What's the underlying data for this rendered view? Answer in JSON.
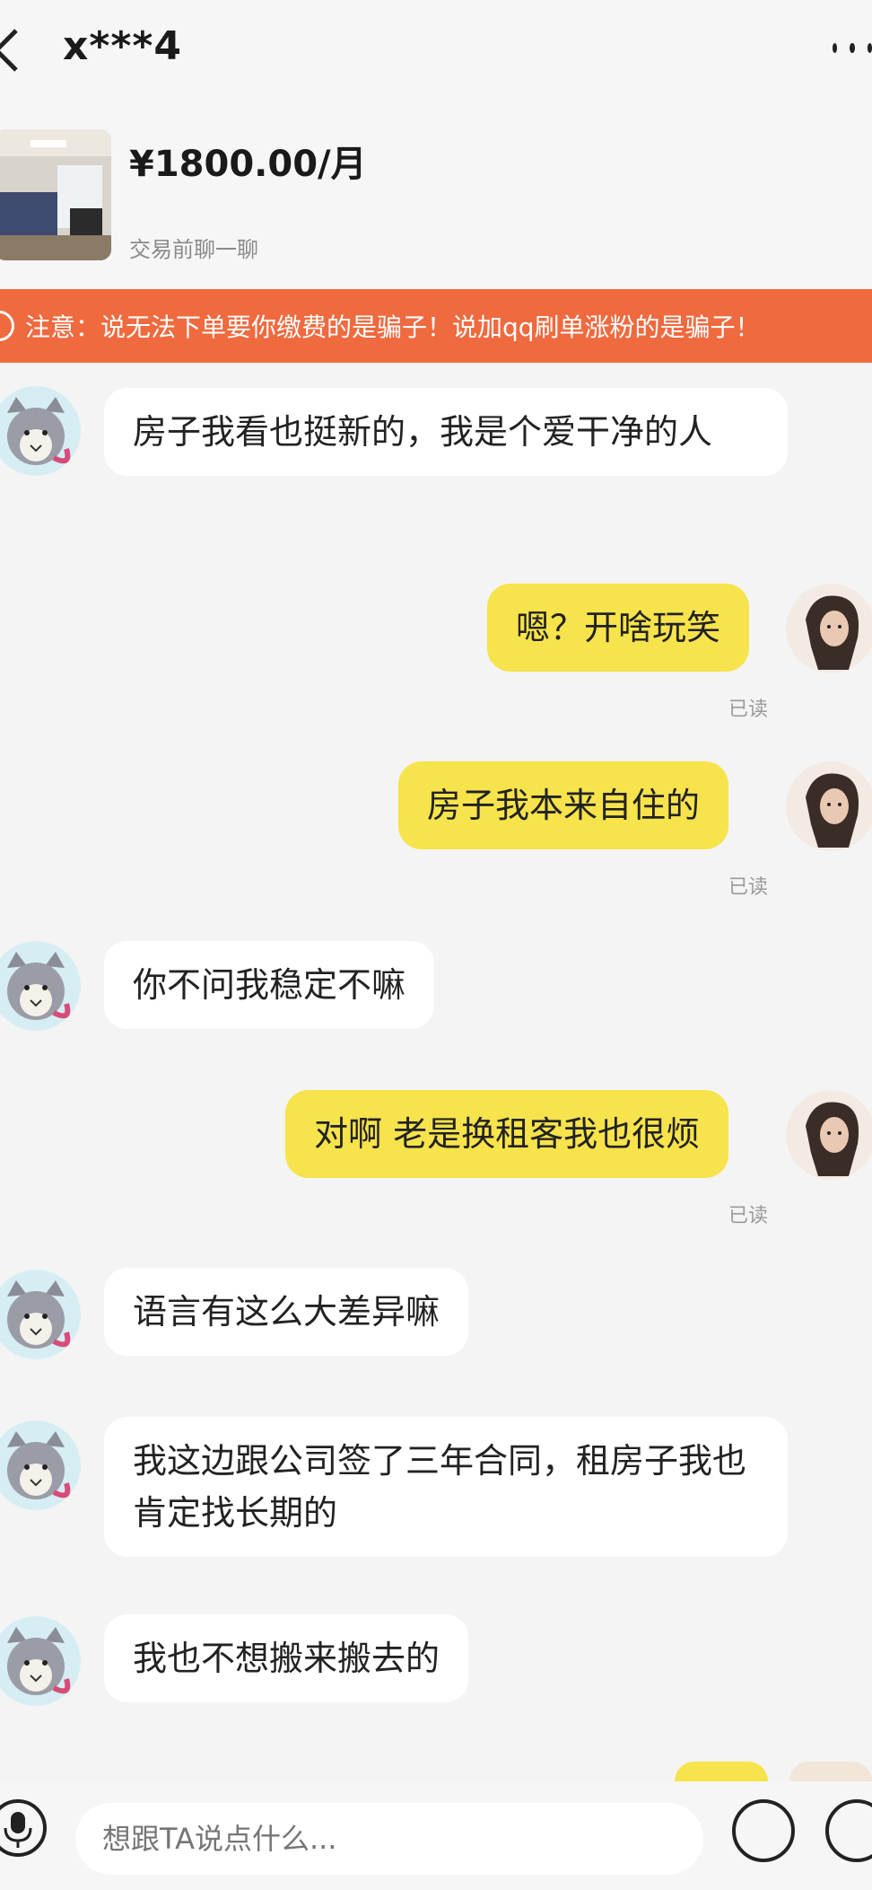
{
  "header": {
    "title": "x***4"
  },
  "product": {
    "price": "¥1800.00/月",
    "subtitle": "交易前聊一聊"
  },
  "warning": {
    "text": "注意：说无法下单要你缴费的是骗子！说加qq刷单涨粉的是骗子！"
  },
  "messages": [
    {
      "side": "left",
      "text": "房子我看也挺新的，我是个爱干净的人"
    },
    {
      "side": "right",
      "text": "嗯？开啥玩笑",
      "status": "已读"
    },
    {
      "side": "right",
      "text": "房子我本来自住的",
      "status": "已读"
    },
    {
      "side": "left",
      "text": "你不问我稳定不嘛"
    },
    {
      "side": "right",
      "text": "对啊 老是换租客我也很烦",
      "status": "已读"
    },
    {
      "side": "left",
      "text": "语言有这么大差异嘛"
    },
    {
      "side": "left",
      "text": "我这边跟公司签了三年合同，租房子我也肯定找长期的"
    },
    {
      "side": "left",
      "text": "我也不想搬来搬去的"
    }
  ],
  "input": {
    "placeholder": "想跟TA说点什么..."
  },
  "icons": {
    "back": "chevron-left-icon",
    "more": "more-dots-icon",
    "warning": "info-circle-icon",
    "mic": "microphone-icon",
    "emoji": "emoji-icon",
    "plus": "plus-icon"
  }
}
